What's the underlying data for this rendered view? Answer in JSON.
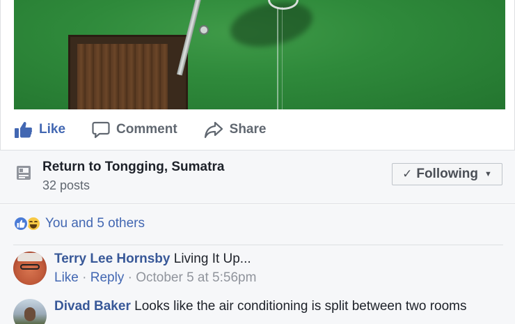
{
  "post": {
    "actions": {
      "like_label": "Like",
      "comment_label": "Comment",
      "share_label": "Share"
    }
  },
  "group": {
    "title": "Return to Tongging, Sumatra",
    "post_count": "32 posts",
    "following_label": "Following"
  },
  "reactions": {
    "summary": "You and 5 others",
    "types": [
      "like-icon",
      "haha-icon"
    ]
  },
  "comments": [
    {
      "author": "Terry Lee Hornsby",
      "text": "Living It Up...",
      "like_label": "Like",
      "reply_label": "Reply",
      "timestamp": "October 5 at 5:56pm"
    },
    {
      "author": "Divad Baker",
      "text": "Looks like the air conditioning is split between two rooms"
    }
  ],
  "colors": {
    "link_blue": "#4267b2",
    "author_blue": "#385898",
    "muted_gray": "#90949c",
    "panel_bg": "#f6f7f9"
  }
}
